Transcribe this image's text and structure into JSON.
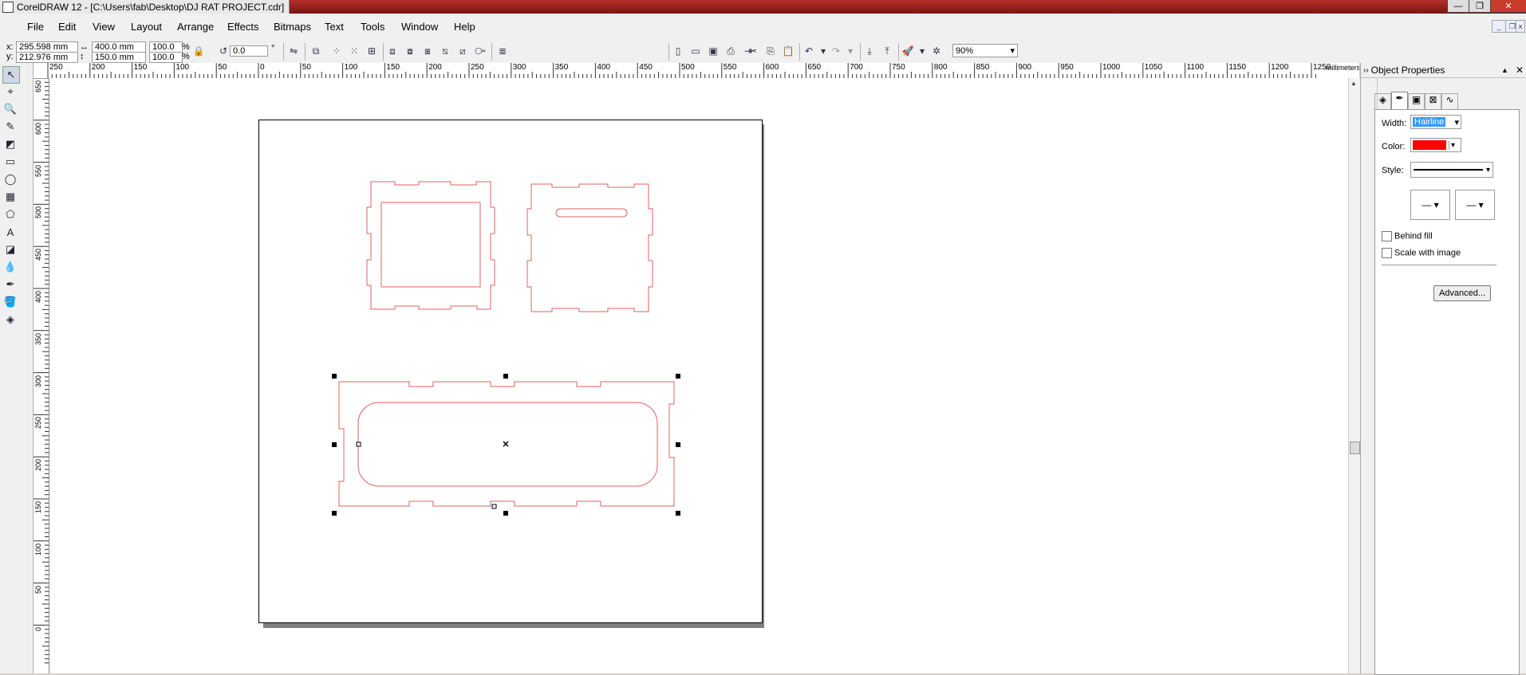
{
  "window": {
    "title": "CorelDRAW 12 - [C:\\Users\\fab\\Desktop\\DJ RAT PROJECT.cdr]",
    "controls": {
      "minimize": "—",
      "restore": "❐",
      "close": "✕"
    }
  },
  "menu": [
    "File",
    "Edit",
    "View",
    "Layout",
    "Arrange",
    "Effects",
    "Bitmaps",
    "Text",
    "Tools",
    "Window",
    "Help"
  ],
  "propbar": {
    "x_label": "x:",
    "x_value": "295.598 mm",
    "y_label": "y:",
    "y_value": "212.976 mm",
    "width_value": "400.0 mm",
    "height_value": "150.0 mm",
    "scale_x": "100.0",
    "scale_y": "100.0",
    "percent": "%",
    "rotation": "0.0",
    "degree": "°",
    "zoom": "90%"
  },
  "ruler": {
    "units": "millimeters",
    "top_labels": [
      "250",
      "200",
      "150",
      "100",
      "50",
      "0",
      "50",
      "100",
      "150",
      "200",
      "250",
      "300",
      "350",
      "400",
      "450",
      "500",
      "550",
      "600",
      "650",
      "700",
      "750",
      "800",
      "850",
      "900",
      "950",
      "1000",
      "1050",
      "1100",
      "1150",
      "1200",
      "1250"
    ],
    "left_labels": [
      "650",
      "600",
      "550",
      "500",
      "450",
      "400",
      "350",
      "300",
      "250",
      "200",
      "150",
      "100",
      "50",
      "0"
    ]
  },
  "docker": {
    "title": "Object Properties",
    "width_label": "Width:",
    "width_value": "Hairline",
    "color_label": "Color:",
    "color_value": "#ff0000",
    "style_label": "Style:",
    "behind_fill": "Behind fill",
    "scale_with_image": "Scale with image",
    "advanced_button": "Advanced..."
  },
  "colors": {
    "outline": "#e06060",
    "accent": "#3399ff"
  }
}
